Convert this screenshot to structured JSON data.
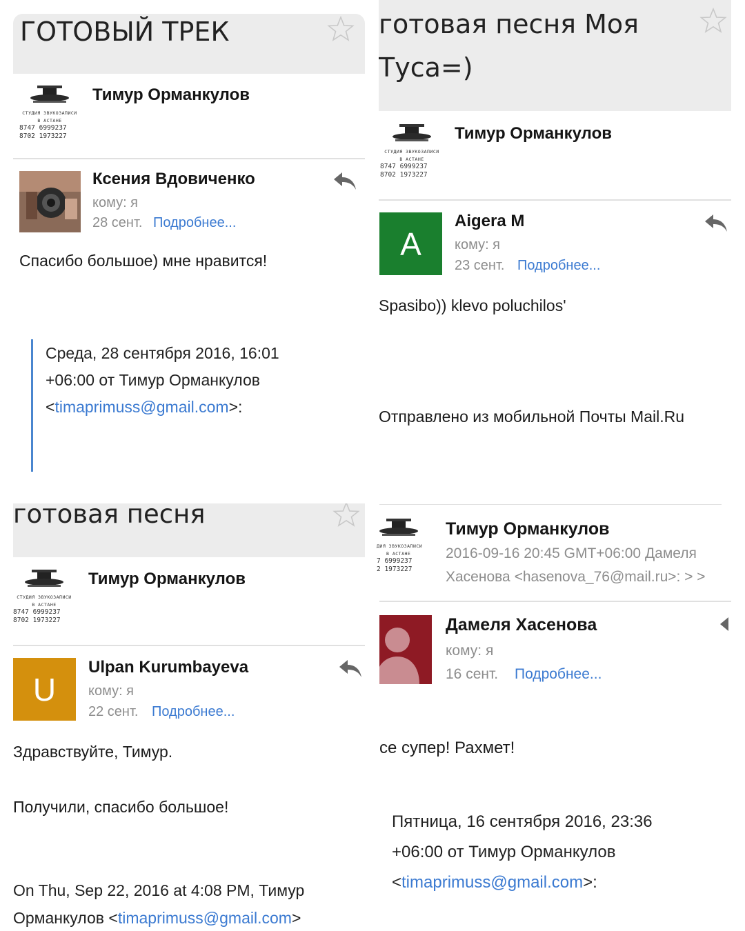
{
  "panel1": {
    "subject": "ГОТОВЫЙ ТРЕК",
    "sender_name": "Тимур Орманкулов",
    "logo": {
      "line1": "СТУДИЯ ЗВУКОЗАПИСИ",
      "line2": "В АСТАНЕ",
      "phone1": "8747 6999237",
      "phone2": "8702 1973227"
    },
    "reply_from": "Ксения Вдовиченко",
    "to_label": "кому: я",
    "date": "28 сент.",
    "details_link": "Подробнее...",
    "body": "Спасибо большое) мне нравится!",
    "quote_line1": "Среда, 28 сентября 2016, 16:01",
    "quote_line2": "+06:00 от Тимур Орманкулов",
    "quote_lt": "<",
    "quote_email": "timaprimuss@gmail.com",
    "quote_gt": ">:"
  },
  "panel2": {
    "subject_line1": "готовая песня Моя",
    "subject_line2": "Туса=)",
    "sender_name": "Тимур Орманкулов",
    "logo": {
      "line1": "СТУДИЯ ЗВУКОЗАПИСИ",
      "line2": "В АСТАНЕ",
      "phone1": "8747 6999237",
      "phone2": "8702 1973227"
    },
    "reply_from": "Aigera M",
    "avatar_letter": "A",
    "to_label": "кому: я",
    "date": "23 сент.",
    "details_link": "Подробнее...",
    "body": "Spasibo)) klevo poluchilos'",
    "footer": "Отправлено из мобильной Почты Mail.Ru",
    "colors": {
      "avatar": "#1a7f2e"
    }
  },
  "panel3": {
    "subject": "готовая песня",
    "sender_name": "Тимур Орманкулов",
    "logo": {
      "line1": "СТУДИЯ ЗВУКОЗАПИСИ",
      "line2": "В АСТАНЕ",
      "phone1": "8747 6999237",
      "phone2": "8702 1973227"
    },
    "reply_from": "Ulpan Kurumbayeva",
    "avatar_letter": "U",
    "to_label": "кому: я",
    "date": "22 сент.",
    "details_link": "Подробнее...",
    "body1": "Здравствуйте, Тимур.",
    "body2": "Получили, спасибо большое!",
    "quote_line1": "On Thu, Sep 22, 2016 at 4:08 PM, Тимур",
    "quote_line2_prefix": "Орманкулов <",
    "quote_email": "timaprimuss@gmail.com",
    "quote_gt": ">",
    "colors": {
      "avatar": "#d4900d"
    }
  },
  "panel4": {
    "sender_name": "Тимур Орманкулов",
    "logo": {
      "line1": "ДИЯ ЗВУКОЗАПИСИ",
      "line2": "В АСТАНЕ",
      "phone1": "7 6999237",
      "phone2": "2 1973227"
    },
    "preview_line1": "2016-09-16 20:45 GMT+06:00 Дамеля",
    "preview_line2": "Хасенова <hasenova_76@mail.ru>: > >",
    "reply_from": "Дамеля Хасенова",
    "to_label": "кому: я",
    "date": "16 сент.",
    "details_link": "Подробнее...",
    "body": "се супер! Рахмет!",
    "quote_line1": "Пятница, 16 сентября 2016, 23:36",
    "quote_line2": "+06:00 от Тимур Орманкулов",
    "quote_lt": "<",
    "quote_email": "timaprimuss@gmail.com",
    "quote_gt": ">:",
    "colors": {
      "avatar": "#8e1a24"
    }
  }
}
